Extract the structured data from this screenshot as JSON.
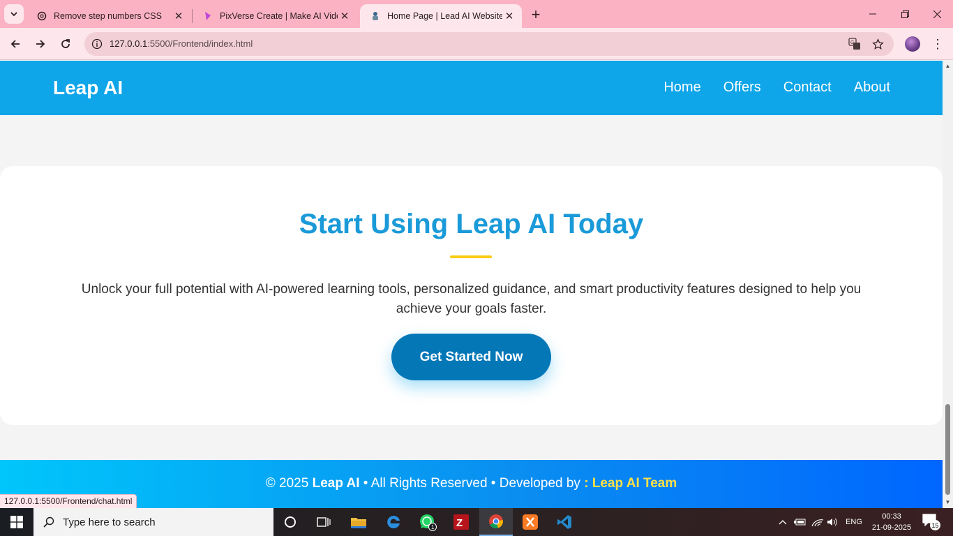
{
  "browser": {
    "tabs": [
      {
        "title": "Remove step numbers CSS",
        "icon": "chatgpt-icon",
        "active": false
      },
      {
        "title": "PixVerse Create | Make AI Video",
        "icon": "pixverse-icon",
        "active": false
      },
      {
        "title": "Home Page | Lead AI Website",
        "icon": "site-favicon",
        "active": true
      }
    ],
    "url_host": "127.0.0.1",
    "url_rest": ":5500/Frontend/index.html",
    "status_url": "127.0.0.1:5500/Frontend/chat.html"
  },
  "site": {
    "brand": "Leap AI",
    "nav": [
      "Home",
      "Offers",
      "Contact",
      "About"
    ]
  },
  "cta": {
    "title": "Start Using Leap AI Today",
    "text": "Unlock your full potential with AI-powered learning tools, personalized guidance, and smart productivity features designed to help you achieve your goals faster.",
    "button": "Get Started Now"
  },
  "footer": {
    "copyright": "© 2025 ",
    "brand": "Leap AI",
    "middle": " • All Rights Reserved • Developed by ",
    "team": ": Leap AI Team"
  },
  "taskbar": {
    "search_placeholder": "Type here to search",
    "language": "ENG",
    "time": "00:33",
    "date": "21-09-2025",
    "whatsapp_badge": "1",
    "notification_count": "15"
  },
  "colors": {
    "header_blue": "#0ea5e9",
    "title_blue": "#1a9ad8",
    "button_blue": "#0477b7",
    "accent_yellow": "#facc15",
    "tabbar_pink": "#fbb3c3"
  }
}
